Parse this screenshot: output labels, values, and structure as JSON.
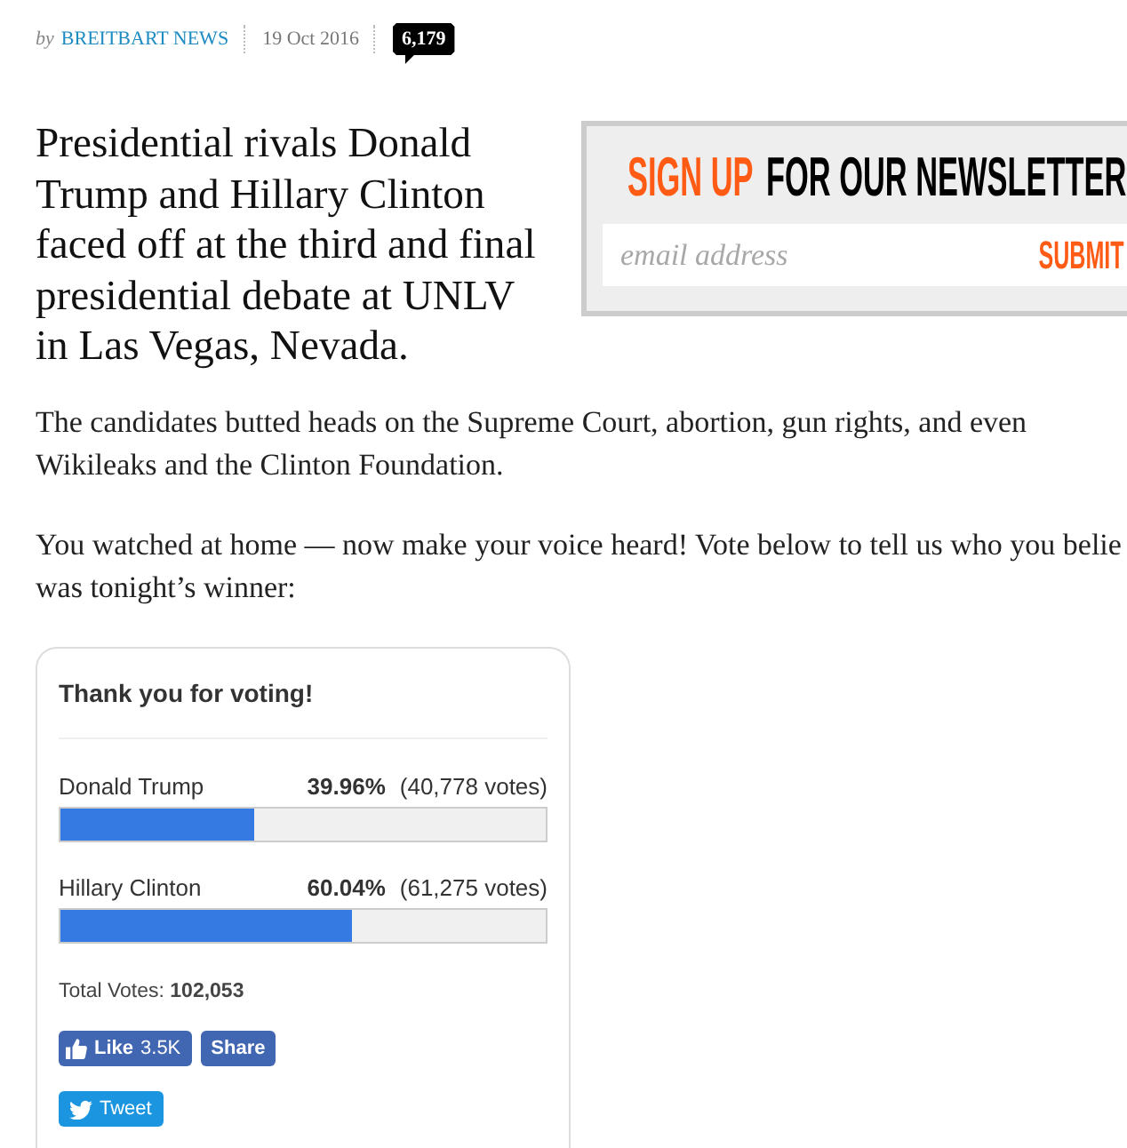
{
  "byline": {
    "prefix": "by",
    "author": "BREITBART NEWS",
    "date": "19 Oct 2016",
    "comment_count": "6,179"
  },
  "headline": {
    "lines": [
      "Presidential rivals Donald",
      "Trump and Hillary Clinton",
      "faced off at the third and final",
      "presidential debate at UNLV",
      "in Las Vegas, Nevada."
    ]
  },
  "newsletter": {
    "title_highlight": "SIGN UP",
    "title_rest": "FOR OUR NEWSLETTER",
    "email_field": {
      "placeholder": "email address"
    },
    "submit_button": "SUBMIT"
  },
  "paragraphs": [
    {
      "lines": [
        "The candidates butted heads on the Supreme Court, abortion, gun rights, and even",
        "Wikileaks and the Clinton Foundation."
      ]
    },
    {
      "lines": [
        "You watched at home — now make your voice heard! Vote below to tell us who you belie",
        "was tonight’s winner:"
      ]
    }
  ],
  "poll": {
    "title": "Thank you for voting!",
    "options": [
      {
        "name": "Donald Trump",
        "percentage": "39.96%",
        "votes": "(40,778 votes)",
        "level": 0.3996
      },
      {
        "name": "Hillary Clinton",
        "percentage": "60.04%",
        "votes": "(61,275 votes)",
        "level": 0.6004
      }
    ],
    "total_votes": "Total Votes: **102,053**",
    "like_button": {
      "label": "Like",
      "count": "3.5K"
    },
    "share_button": "Share",
    "tweet_button": "Tweet"
  }
}
